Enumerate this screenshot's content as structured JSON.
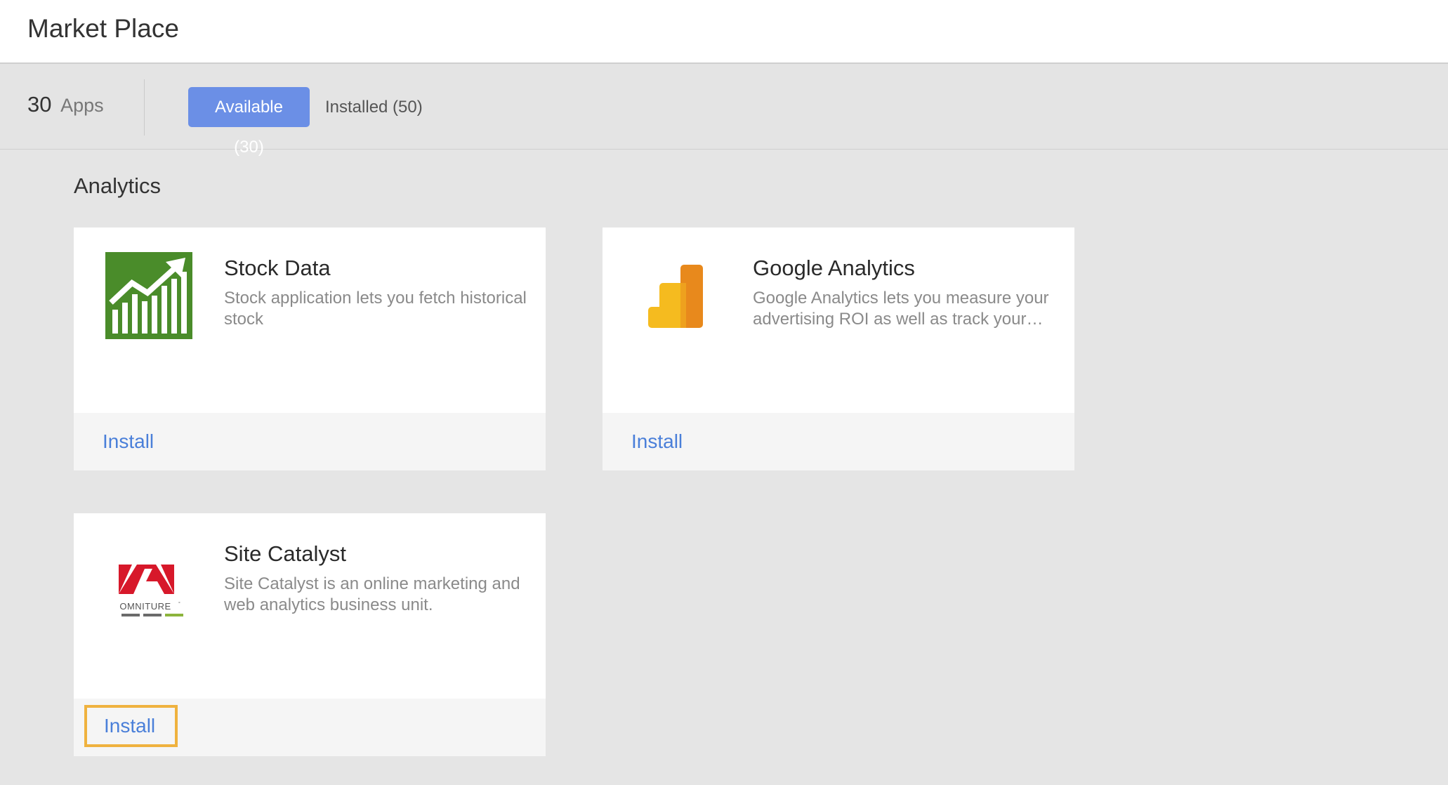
{
  "header": {
    "title": "Market Place"
  },
  "filter": {
    "count": "30",
    "count_label": "Apps",
    "tabs": [
      {
        "label": "Available (30)",
        "active": true
      },
      {
        "label": "Installed (50)",
        "active": false
      }
    ]
  },
  "section": {
    "title": "Analytics"
  },
  "apps": [
    {
      "name": "Stock Data",
      "description": "Stock application lets you fetch historical stock",
      "action": "Install",
      "icon": "stock-chart-icon",
      "icon_color": "#4a8c2a"
    },
    {
      "name": "Google Analytics",
      "description": "Google Analytics lets you measure your advertising ROI as well as track your…",
      "action": "Install",
      "icon": "google-analytics-icon",
      "icon_color": "#e8891c"
    },
    {
      "name": "Site Catalyst",
      "description": "Site Catalyst is an online marketing and web analytics business unit.",
      "action": "Install",
      "icon": "adobe-omniture-icon",
      "icon_color": "#d7182a",
      "logo_text": "OMNITURE"
    }
  ],
  "colors": {
    "accent": "#6b8fe6",
    "link": "#4a7fd9",
    "focus_outline": "#efb23f"
  }
}
